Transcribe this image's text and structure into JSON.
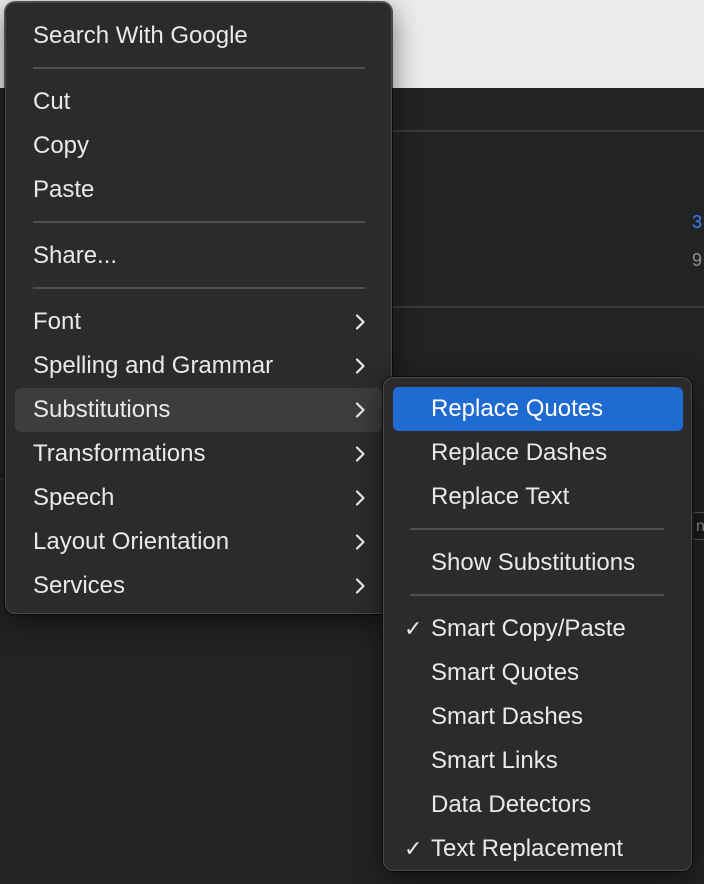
{
  "background": {
    "right_text_1": "3",
    "right_text_2": "9",
    "right_field_text": "n",
    "accent_color": "#3b82f6"
  },
  "main_menu": {
    "search": "Search With Google",
    "cut": "Cut",
    "copy": "Copy",
    "paste": "Paste",
    "share": "Share...",
    "font": "Font",
    "spelling": "Spelling and Grammar",
    "substitutions": "Substitutions",
    "transformations": "Transformations",
    "speech": "Speech",
    "layout_orientation": "Layout Orientation",
    "services": "Services"
  },
  "sub_menu": {
    "replace_quotes": "Replace Quotes",
    "replace_dashes": "Replace Dashes",
    "replace_text": "Replace Text",
    "show_substitutions": "Show Substitutions",
    "smart_copy_paste": "Smart Copy/Paste",
    "smart_quotes": "Smart Quotes",
    "smart_dashes": "Smart Dashes",
    "smart_links": "Smart Links",
    "data_detectors": "Data Detectors",
    "text_replacement": "Text Replacement",
    "checkmark": "✓"
  },
  "icons": {
    "submenu_arrow": "chevron-right-icon",
    "check": "checkmark-icon"
  },
  "colors": {
    "menu_bg": "#2b2b2d",
    "selected_bg": "#1f6bd1",
    "hover_bg": "#3d3d40",
    "text": "#e9e9eb"
  }
}
